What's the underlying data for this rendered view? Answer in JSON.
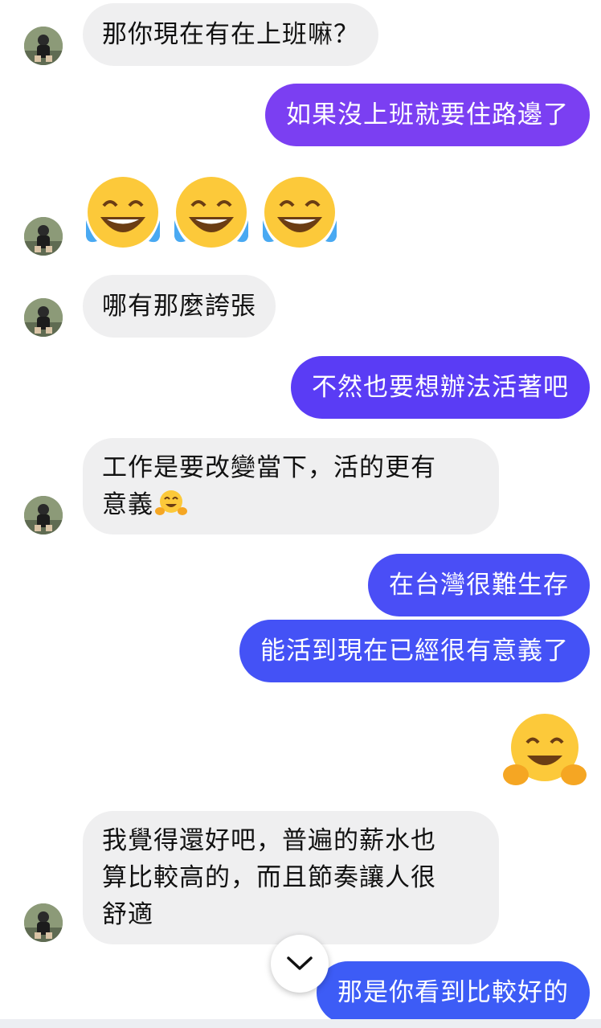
{
  "conversation": {
    "messages": [
      {
        "side": "in",
        "text": "那你現在有在上班嘛？"
      },
      {
        "side": "out",
        "text": "如果沒上班就要住路邊了"
      },
      {
        "side": "in",
        "emoji": "tears-of-joy-x3"
      },
      {
        "side": "in",
        "text": "哪有那麼誇張"
      },
      {
        "side": "out",
        "text": "不然也要想辦法活著吧"
      },
      {
        "side": "in",
        "lines": [
          "工作是要改變當下，活的更有",
          "意義"
        ],
        "trailing_emoji": "hugging-face"
      },
      {
        "side": "out",
        "text": "在台灣很難生存"
      },
      {
        "side": "out",
        "text": "能活到現在已經很有意義了"
      },
      {
        "side": "out",
        "emoji": "hugging-face"
      },
      {
        "side": "in",
        "lines": [
          "我覺得還好吧，普遍的薪水也",
          "算比較高的，而且節奏讓人很",
          "舒適"
        ]
      },
      {
        "side": "out",
        "text": "那是你看到比較好的"
      }
    ]
  },
  "ui": {
    "scroll_down_icon": "chevron-down-icon"
  },
  "colors": {
    "incoming_bubble": "#efeff0",
    "outgoing_top": "#7b3ff2",
    "outgoing_mid": "#5a3cf5",
    "outgoing_bottom": "#3d5cf6"
  }
}
